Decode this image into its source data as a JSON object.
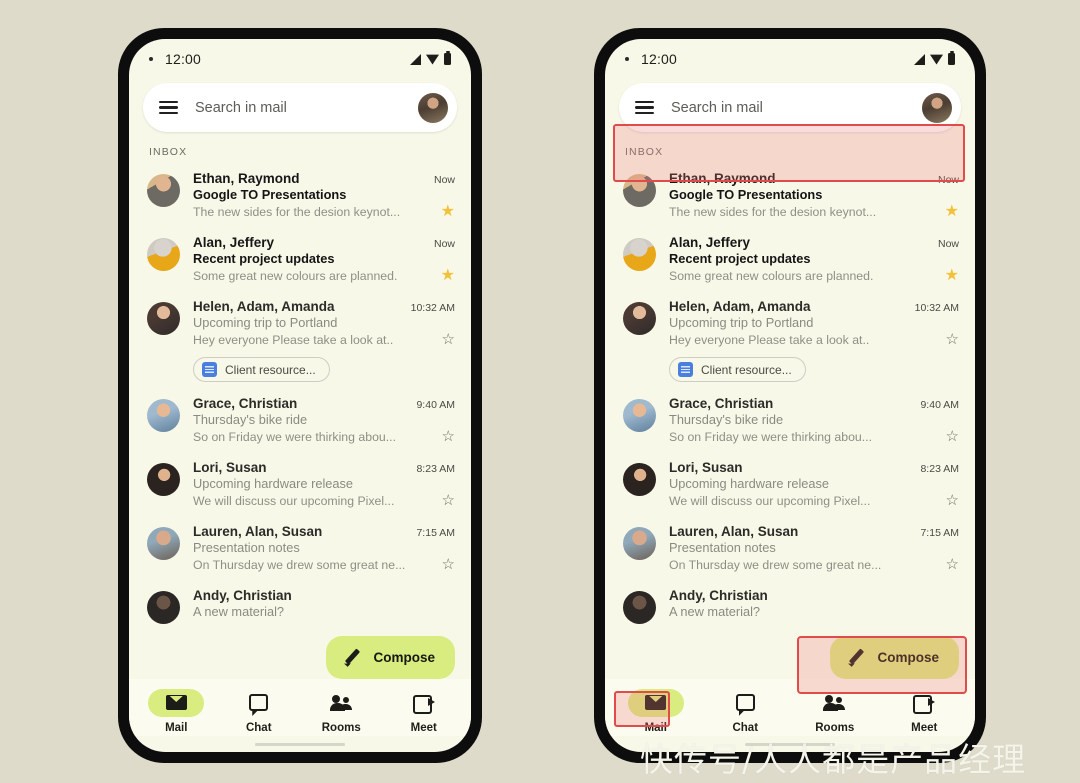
{
  "background_color": "#dedbca",
  "screen_color": "#f8f8e9",
  "accent_color": "#d9ec80",
  "highlight_color": "#e04b4b",
  "star_color": "#f3c23c",
  "status_bar": {
    "time": "12:00",
    "icons": [
      "signal-icon",
      "wifi-icon",
      "battery-icon"
    ]
  },
  "search": {
    "menu_icon": "hamburger-menu-icon",
    "placeholder": "Search in mail",
    "avatar": "account-avatar"
  },
  "inbox": {
    "label": "INBOX"
  },
  "emails": [
    {
      "sender": "Ethan, Raymond",
      "subject": "Google TO Presentations",
      "snippet": "The new sides for the desion keynot...",
      "time": "Now",
      "unread": true,
      "starred": true,
      "chip": null
    },
    {
      "sender": "Alan, Jeffery",
      "subject": "Recent project updates",
      "snippet": "Some great new colours are planned.",
      "time": "Now",
      "unread": true,
      "starred": true,
      "chip": null
    },
    {
      "sender": "Helen, Adam, Amanda",
      "subject": "Upcoming trip to Portland",
      "snippet": "Hey everyone Please take a look at..",
      "time": "10:32 AM",
      "unread": false,
      "starred": false,
      "chip": "Client resource..."
    },
    {
      "sender": "Grace, Christian",
      "subject": "Thursday's bike ride",
      "snippet": "So on Friday we were thirking abou...",
      "time": "9:40 AM",
      "unread": false,
      "starred": false,
      "chip": null
    },
    {
      "sender": "Lori, Susan",
      "subject": "Upcoming hardware release",
      "snippet": "We will discuss our upcoming Pixel...",
      "time": "8:23 AM",
      "unread": false,
      "starred": false,
      "chip": null
    },
    {
      "sender": "Lauren, Alan, Susan",
      "subject": "Presentation notes",
      "snippet": "On Thursday we drew some great ne...",
      "time": "7:15 AM",
      "unread": false,
      "starred": false,
      "chip": null
    },
    {
      "sender": "Andy, Christian",
      "subject": "A new material?",
      "snippet": "",
      "time": "",
      "unread": false,
      "starred": false,
      "chip": null
    }
  ],
  "compose": {
    "label": "Compose",
    "icon": "pencil-icon"
  },
  "nav": [
    {
      "label": "Mail",
      "icon": "mail-icon",
      "active": true
    },
    {
      "label": "Chat",
      "icon": "chat-icon",
      "active": false
    },
    {
      "label": "Rooms",
      "icon": "rooms-icon",
      "active": false
    },
    {
      "label": "Meet",
      "icon": "meet-icon",
      "active": false
    }
  ],
  "watermark": "快传号/人人都是产品经理"
}
